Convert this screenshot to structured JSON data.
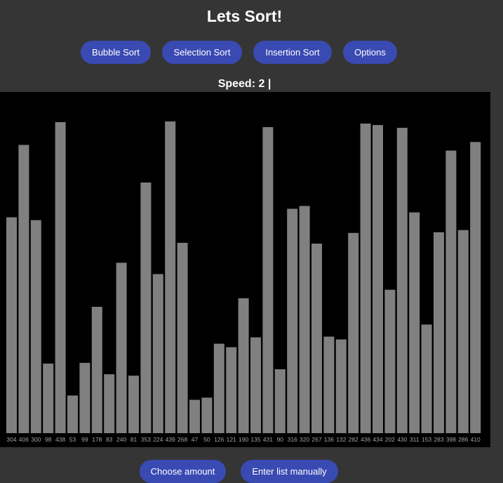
{
  "header": {
    "title": "Lets Sort!"
  },
  "toolbar": {
    "bubble_sort": "Bubble Sort",
    "selection_sort": "Selection Sort",
    "insertion_sort": "Insertion Sort",
    "options": "Options"
  },
  "status": {
    "speed_text": "Speed: 2 |"
  },
  "footer": {
    "choose_amount": "Choose amount",
    "enter_list": "Enter list manually"
  },
  "colors": {
    "background": "#353535",
    "accent": "#3a4ab3",
    "bar": "#808080",
    "canvas": "#000000",
    "label": "#a0a0a0"
  },
  "chart_data": {
    "type": "bar",
    "values": [
      304,
      406,
      300,
      98,
      438,
      53,
      99,
      178,
      83,
      240,
      81,
      353,
      224,
      439,
      268,
      47,
      50,
      126,
      121,
      190,
      135,
      431,
      90,
      316,
      320,
      267,
      136,
      132,
      282,
      436,
      434,
      202,
      430,
      311,
      153,
      283,
      398,
      286,
      410
    ],
    "title": "",
    "xlabel": "",
    "ylabel": ""
  }
}
